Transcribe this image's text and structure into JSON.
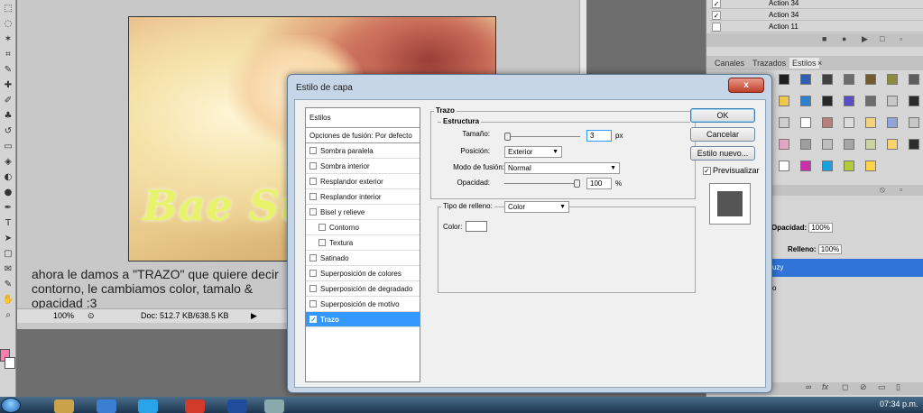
{
  "colors": {
    "foreground": "#ff7cae",
    "background": "#ffffff",
    "selection": "#3399ff"
  },
  "toolbar": {
    "tools": [
      "marquee-icon",
      "lasso-icon",
      "magic-wand-icon",
      "crop-icon",
      "eyedropper-icon",
      "healing-icon",
      "brush-icon",
      "clone-icon",
      "history-brush-icon",
      "eraser-icon",
      "paint-bucket-icon",
      "blur-icon",
      "dodge-icon",
      "pen-icon",
      "text-icon",
      "path-select-icon",
      "shape-icon",
      "notes-icon",
      "eyedropper2-icon",
      "hand-icon",
      "zoom-icon"
    ]
  },
  "document": {
    "photo_text": "Bae Suz",
    "caption": "ahora le damos a \"TRAZO\" que quiere decir contorno, le cambiamos color, tamalo & opacidad :3",
    "zoom": "100%",
    "doc_size": "Doc: 512.7 KB/638.5 KB"
  },
  "actions": {
    "rows": [
      {
        "label": "Action 34",
        "checked": true
      },
      {
        "label": "Action 34",
        "checked": true
      },
      {
        "label": "Action 11",
        "checked": false
      }
    ]
  },
  "panels": {
    "tabs": [
      "Canales",
      "Trazados",
      "Estilos"
    ],
    "close_glyph": "×",
    "opacity_label": "Opacidad:",
    "opacity_value": "100%",
    "fill_label": "Relleno:",
    "fill_value": "100%",
    "layer_name": "uzy",
    "layer_name2": "o",
    "swatch_colors": [
      "#1e1e1e",
      "#2d5fb4",
      "#404040",
      "#6e6e6e",
      "#735b2c",
      "#8b8b3a",
      "#5c5c5c",
      "#1a3f8a",
      "#f0c74a",
      "#2d7fd0",
      "#272727",
      "#5a4ec0",
      "#6e6e6e",
      "#c7c7c7",
      "#2b2b2b",
      "#8a8a8a",
      "#cfcfcf",
      "#ffffff",
      "#b97f7f",
      "#dcdcdc",
      "#f5d37c",
      "#8fa6d6",
      "#c6c6c6",
      "#cba0e0",
      "#e0a6c4",
      "#9f9f9f",
      "#bebebe",
      "#a6a6a6",
      "#ccd3a0",
      "#f9d46b",
      "#2d2d2d",
      "#8a8a8a",
      "#ffffff",
      "#cc2daa",
      "#1ba0e0",
      "#b4cc3a",
      "#ffd24a"
    ]
  },
  "dialog": {
    "title": "Estilo de capa",
    "close_label": "x",
    "styles_header": "Estilos",
    "blend_options": "Opciones de fusión: Por defecto",
    "items": [
      {
        "label": "Sombra paralela",
        "checked": false,
        "sub": false
      },
      {
        "label": "Sombra interior",
        "checked": false,
        "sub": false
      },
      {
        "label": "Resplandor exterior",
        "checked": false,
        "sub": false
      },
      {
        "label": "Resplandor interior",
        "checked": false,
        "sub": false
      },
      {
        "label": "Bisel y relieve",
        "checked": false,
        "sub": false
      },
      {
        "label": "Contorno",
        "checked": false,
        "sub": true
      },
      {
        "label": "Textura",
        "checked": false,
        "sub": true
      },
      {
        "label": "Satinado",
        "checked": false,
        "sub": false
      },
      {
        "label": "Superposición de colores",
        "checked": false,
        "sub": false
      },
      {
        "label": "Superposición de degradado",
        "checked": false,
        "sub": false
      },
      {
        "label": "Superposición de motivo",
        "checked": false,
        "sub": false
      },
      {
        "label": "Trazo",
        "checked": true,
        "sub": false
      }
    ],
    "stroke": {
      "group_title": "Trazo",
      "structure_title": "Estructura",
      "size_label": "Tamaño:",
      "size_value": "3",
      "size_unit": "px",
      "position_label": "Posición:",
      "position_value": "Exterior",
      "blend_label": "Modo de fusión:",
      "blend_value": "Normal",
      "opacity_label": "Opacidad:",
      "opacity_value": "100",
      "opacity_unit": "%",
      "fill_type_label": "Tipo de relleno:",
      "fill_type_value": "Color",
      "color_label": "Color:",
      "stroke_color": "#ffffff"
    },
    "buttons": {
      "ok": "OK",
      "cancel": "Cancelar",
      "new_style": "Estilo nuevo...",
      "preview": "Previsualizar"
    },
    "preview_checked": true
  },
  "taskbar": {
    "clock": "07:34 p.m."
  }
}
